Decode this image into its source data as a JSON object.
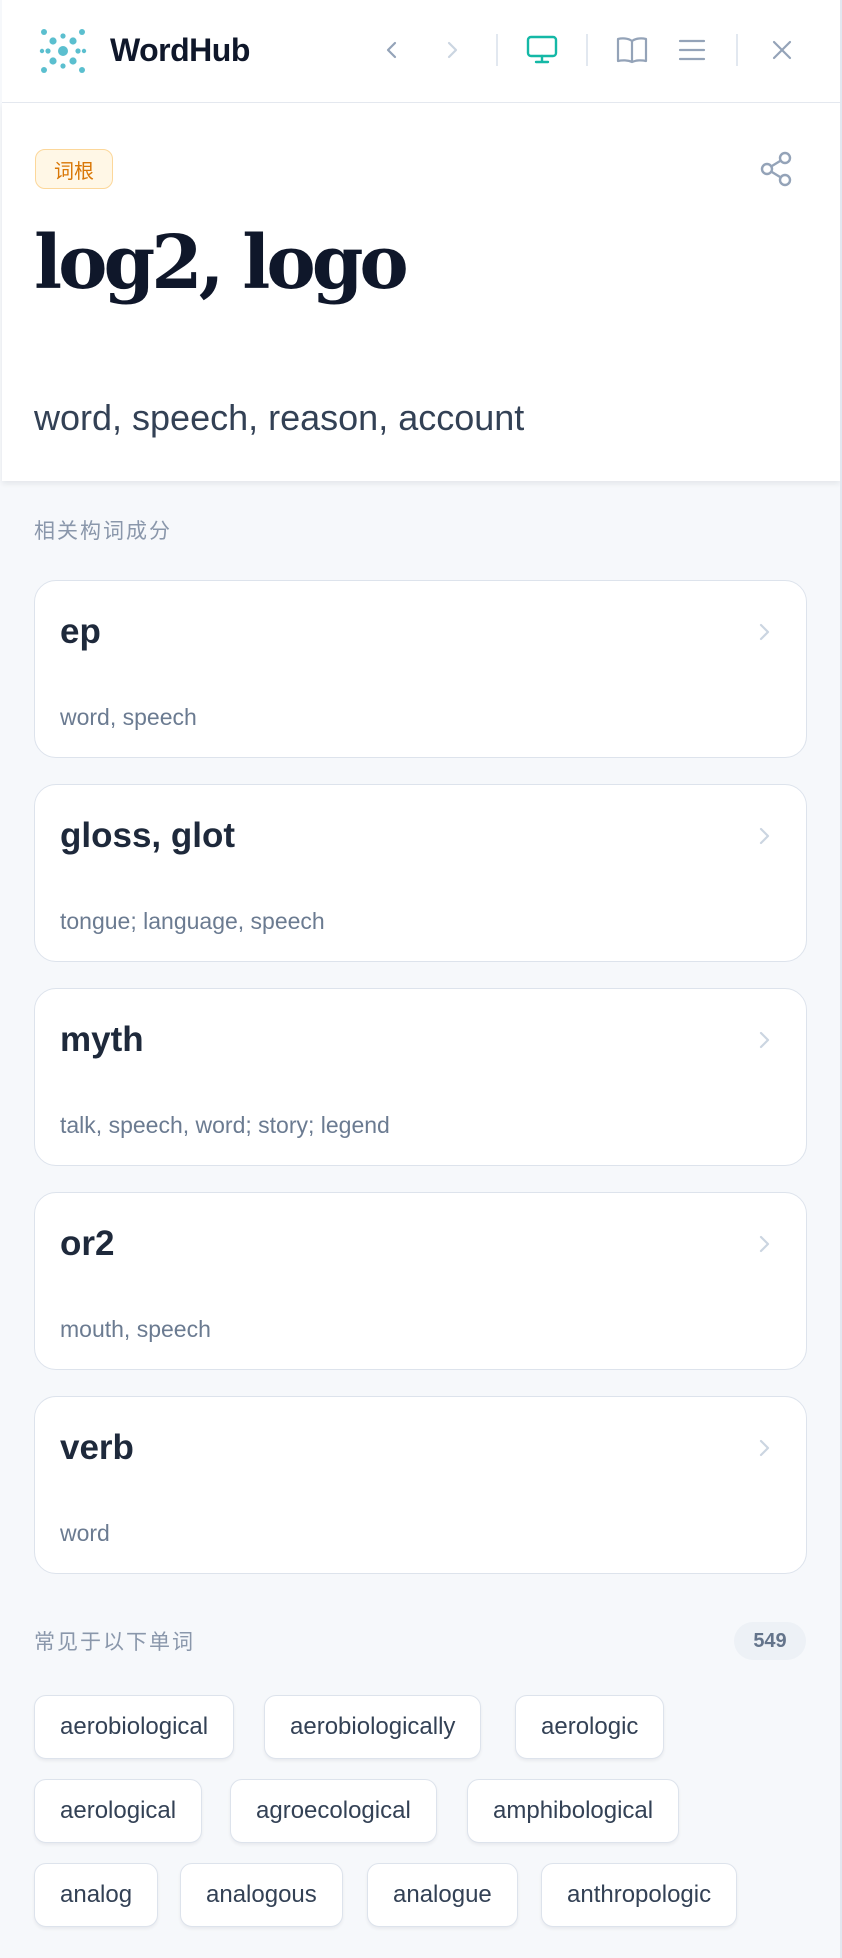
{
  "app": {
    "brand": "WordHub",
    "accent": "#14b8a6",
    "icon_color": "#94a3b8"
  },
  "header": {
    "buttons": [
      {
        "icon": "chevron-left-icon"
      },
      {
        "icon": "chevron-right-icon"
      },
      {
        "icon": "monitor-icon",
        "active": true
      },
      {
        "icon": "book-open-icon"
      },
      {
        "icon": "menu-icon"
      },
      {
        "icon": "close-icon"
      }
    ]
  },
  "root": {
    "badge": "词根",
    "title": "log2, logo",
    "meaning": "word, speech, reason, account",
    "share_icon": "share-icon"
  },
  "related": {
    "label": "相关构词成分",
    "items": [
      {
        "title": "ep",
        "meaning": "word, speech"
      },
      {
        "title": "gloss, glot",
        "meaning": "tongue; language, speech"
      },
      {
        "title": "myth",
        "meaning": "talk, speech, word; story; legend"
      },
      {
        "title": "or2",
        "meaning": "mouth, speech"
      },
      {
        "title": "verb",
        "meaning": "word"
      }
    ]
  },
  "words": {
    "label": "常见于以下单词",
    "count": "549",
    "items": [
      "aerobiological",
      "aerobiologically",
      "aerologic",
      "aerological",
      "agroecological",
      "amphibological",
      "analog",
      "analogous",
      "analogue",
      "anthropologic"
    ]
  }
}
